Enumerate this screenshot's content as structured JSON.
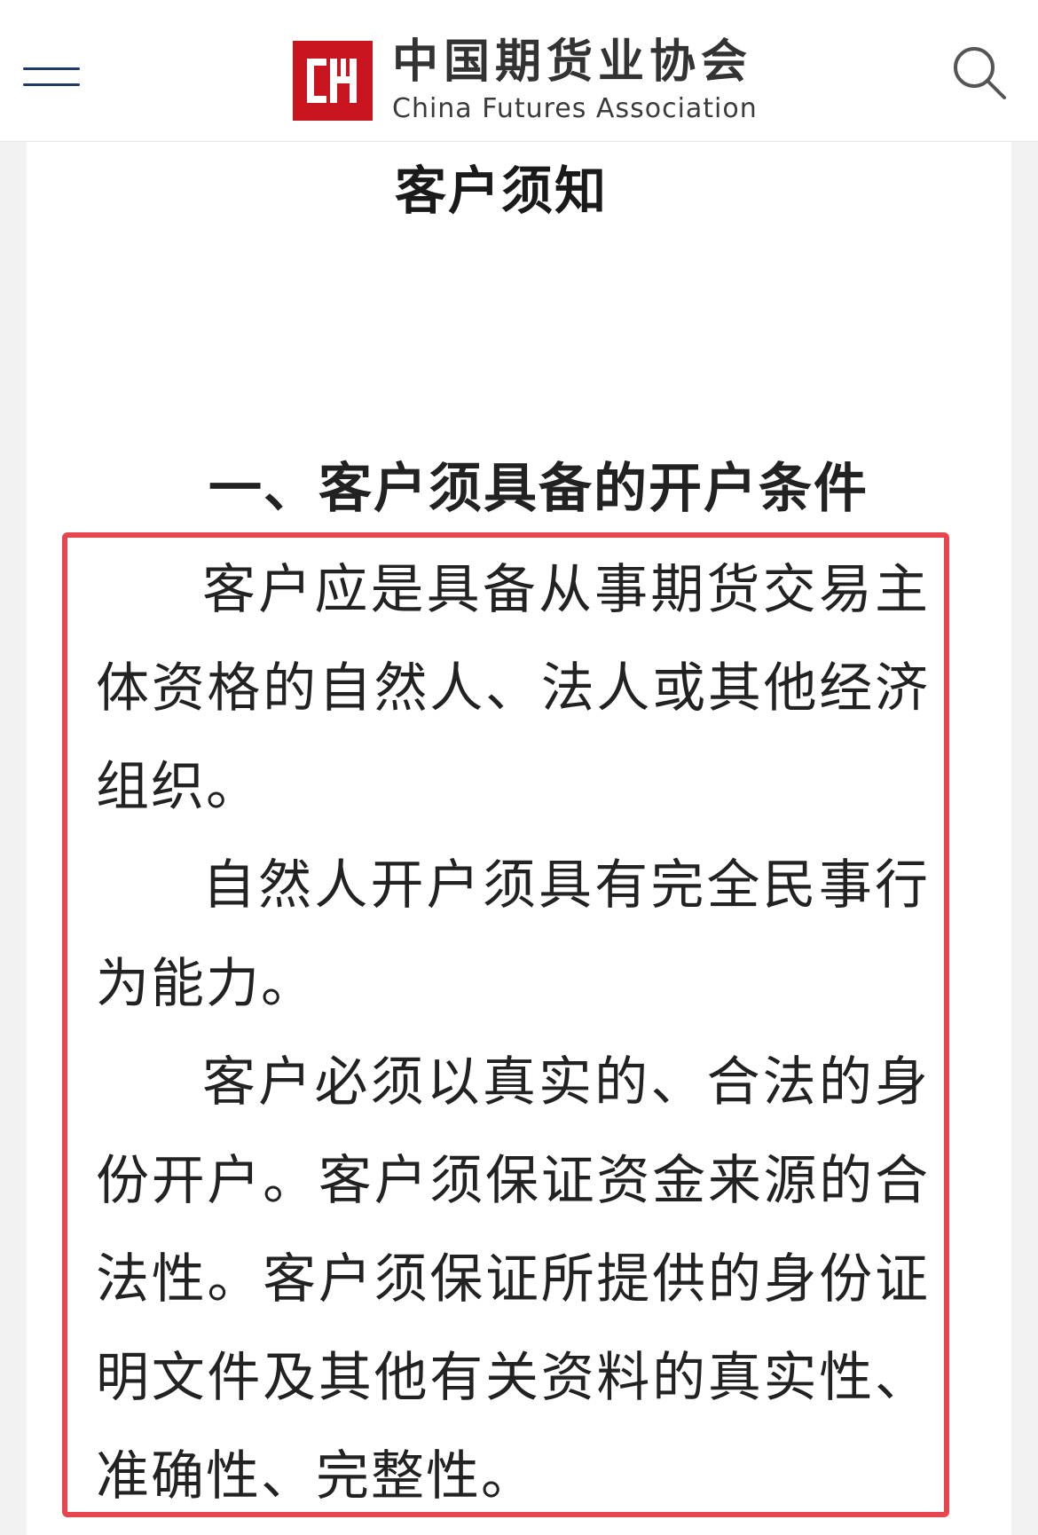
{
  "header": {
    "brand_cn": "中国期货业协会",
    "brand_en": "China Futures Association",
    "menu_icon": "hamburger-menu-icon",
    "search_icon": "search-icon",
    "brand_color": "#c8141e",
    "menu_color": "#1e3a6a"
  },
  "document": {
    "title": "客户须知",
    "section_title": "一、客户须具备的开户条件",
    "paragraphs": [
      "客户应是具备从事期货交易主体资格的自然人、法人或其他经济组织。",
      "自然人开户须具有完全民事行为能力。",
      "客户必须以真实的、合法的身份开户。客户须保证资金来源的合法性。客户须保证所提供的身份证明文件及其他有关资料的真实性、准确性、完整性。"
    ],
    "highlight_color": "#e8464f"
  }
}
